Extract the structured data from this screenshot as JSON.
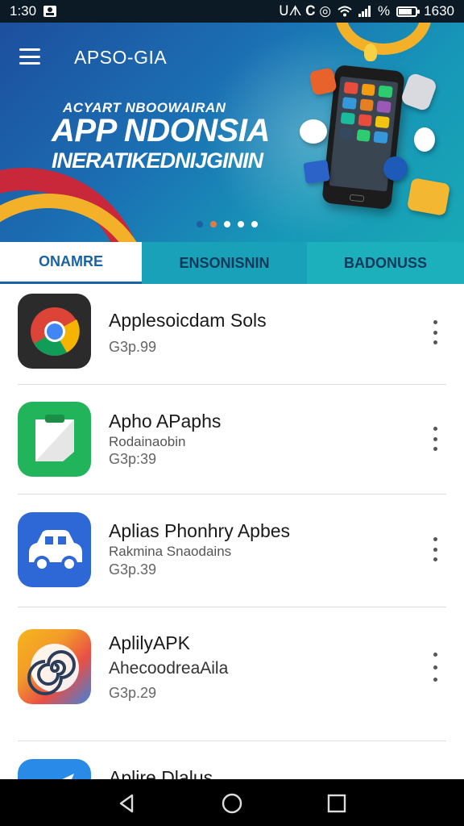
{
  "status_bar": {
    "time": "1:30",
    "icons_text": "ᑌᗑ 𝐂 ◎",
    "percent": "%",
    "right_time": "1630",
    "battery_level_pct": 80
  },
  "header": {
    "app_title": "APSO-GIA",
    "menu_icon": "hamburger-menu-icon"
  },
  "banner": {
    "kicker": "ACYART NBOOWAIRAN",
    "headline": "APP NDONSIA",
    "subline": "INERATIKEDNIJGININ",
    "active_dot": 0
  },
  "tabs": [
    {
      "label": "ONAMRE",
      "active": true
    },
    {
      "label": "ENSONISNIN",
      "active": false
    },
    {
      "label": "BADONUSS",
      "active": false
    }
  ],
  "apps": [
    {
      "title": "Applesoicdam Sols",
      "subtitle": "",
      "price": "G3p.99",
      "icon": "chrome-icon"
    },
    {
      "title": "Apho APaphs",
      "subtitle": "Rodainaobin",
      "price": "G3p:39",
      "icon": "notes-app-icon"
    },
    {
      "title": "Aplias Phonhry Apbes",
      "subtitle": "Rakmina Snaodains",
      "price": "G3p.39",
      "icon": "car-app-icon"
    },
    {
      "title": "AplilyAPK",
      "subtitle": "AhecoodreaAila",
      "price": "G3p.29",
      "icon": "spiral-app-icon"
    },
    {
      "title": "Aplire Dlalus",
      "subtitle": "",
      "price": "",
      "icon": "send-app-icon"
    }
  ],
  "colors": {
    "accent": "#1863a6",
    "tab_bg": "#1aa1ba",
    "banner_red": "#c8283a",
    "banner_yellow": "#f2b129"
  },
  "nav": {
    "back_icon": "back-triangle-icon",
    "home_icon": "home-circle-icon",
    "recents_icon": "recents-square-icon"
  }
}
